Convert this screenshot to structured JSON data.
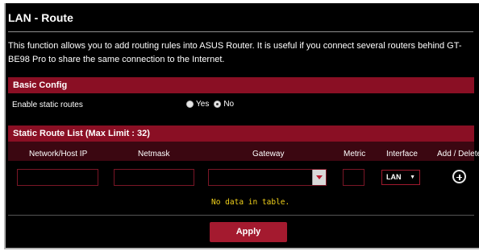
{
  "page": {
    "title": "LAN - Route",
    "description": "This function allows you to add routing rules into ASUS Router. It is useful if you connect several routers behind GT-BE98 Pro to share the same connection to the Internet."
  },
  "basic_config": {
    "header": "Basic Config",
    "static_routes_label": "Enable static routes",
    "options": [
      {
        "label": "Yes",
        "selected": false
      },
      {
        "label": "No",
        "selected": true
      }
    ]
  },
  "route_list": {
    "header": "Static Route List (Max Limit : 32)",
    "columns": [
      "Network/Host IP",
      "Netmask",
      "Gateway",
      "Metric",
      "Interface",
      "Add / Delete"
    ],
    "inputs": {
      "network_ip": "",
      "netmask": "",
      "gateway": "",
      "metric": ""
    },
    "interface_selected": "LAN",
    "empty_message": "No data in table."
  },
  "actions": {
    "apply_label": "Apply"
  },
  "colors": {
    "accent": "#8a0f24",
    "button": "#a41a2f",
    "empty_text": "#f2d21b"
  }
}
